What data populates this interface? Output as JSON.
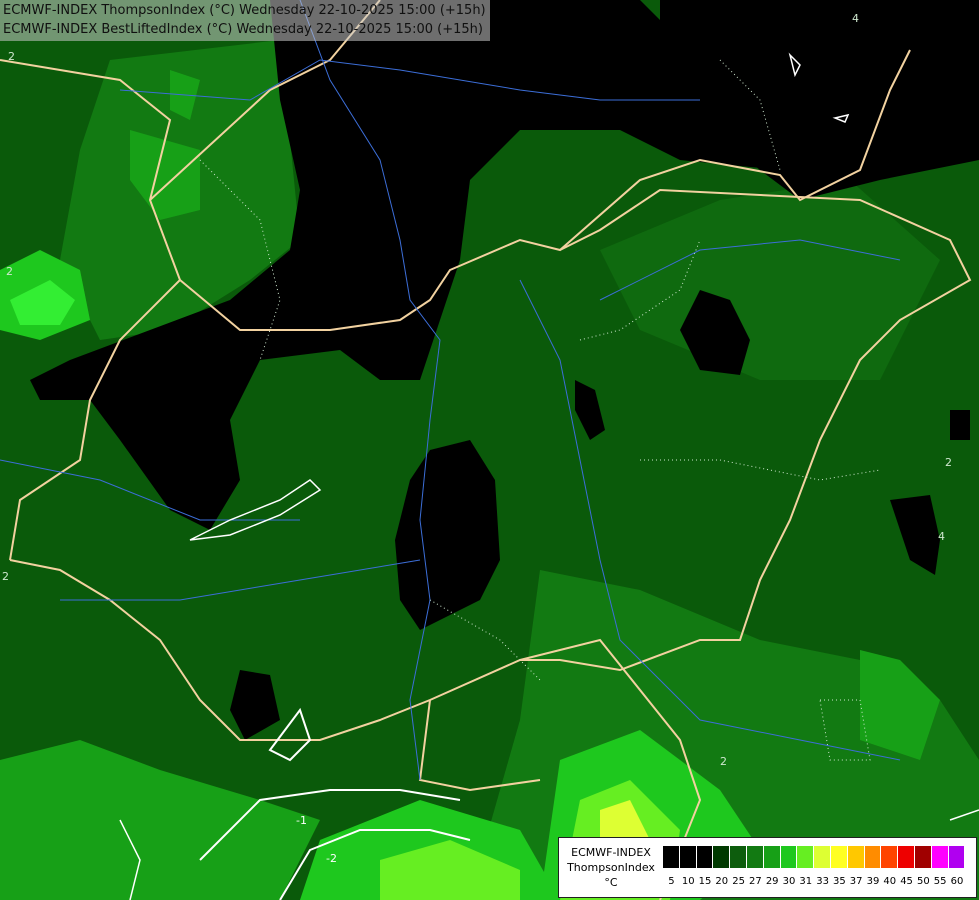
{
  "title": {
    "line1": "ECMWF-INDEX ThompsonIndex (°C) Wednesday 22-10-2025 15:00 (+15h)",
    "line2": "ECMWF-INDEX BestLiftedIndex (°C) Wednesday 22-10-2025 15:00 (+15h)"
  },
  "legend": {
    "model": "ECMWF-INDEX",
    "parameter": "ThompsonIndex",
    "unit": "°C",
    "ticks": [
      "5",
      "10",
      "15",
      "20",
      "25",
      "27",
      "29",
      "30",
      "31",
      "33",
      "35",
      "37",
      "39",
      "40",
      "45",
      "50",
      "55",
      "60"
    ],
    "colors": [
      "#000000",
      "#000000",
      "#000000",
      "#003a00",
      "#0d5d0d",
      "#127a12",
      "#17a017",
      "#1ec81e",
      "#66ee22",
      "#ddff33",
      "#ffff22",
      "#ffc800",
      "#ff8c00",
      "#ff4400",
      "#ee0000",
      "#a00000",
      "#ff00ff",
      "#b000f0",
      "#7020f0",
      "#2020ff"
    ]
  },
  "contour_labels": [
    "4",
    "2",
    "2",
    "2",
    "4",
    "2",
    "-1",
    "-2",
    "2"
  ]
}
